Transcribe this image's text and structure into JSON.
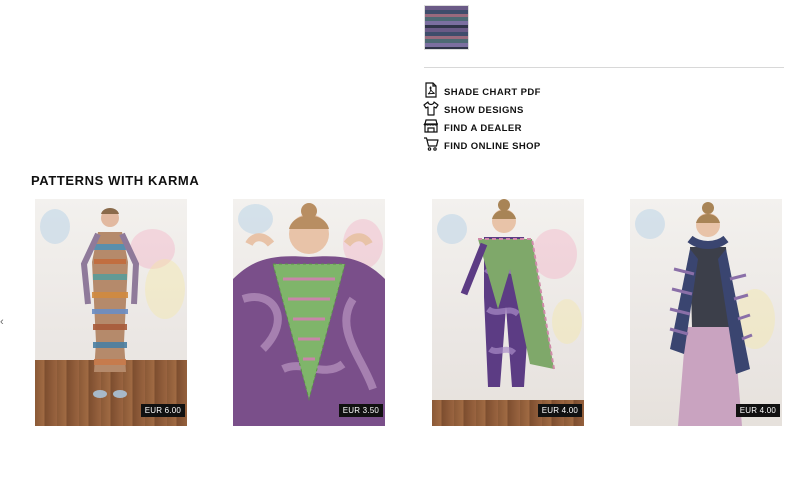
{
  "product": {
    "swatch_icon": "yarn-color-swatch"
  },
  "actions": [
    {
      "label": "SHADE CHART PDF",
      "icon": "pdf-icon"
    },
    {
      "label": "SHOW DESIGNS",
      "icon": "tshirt-icon"
    },
    {
      "label": "FIND A DEALER",
      "icon": "store-icon"
    },
    {
      "label": "FIND ONLINE SHOP",
      "icon": "cart-icon"
    }
  ],
  "patterns": {
    "title": "PATTERNS WITH KARMA",
    "items": [
      {
        "price": "EUR 6.00"
      },
      {
        "price": "EUR 3.50"
      },
      {
        "price": "EUR 4.00"
      },
      {
        "price": "EUR 4.00"
      }
    ]
  },
  "colors": {
    "text": "#111111",
    "divider": "#d8d8d8",
    "price_bg": "#111111"
  }
}
